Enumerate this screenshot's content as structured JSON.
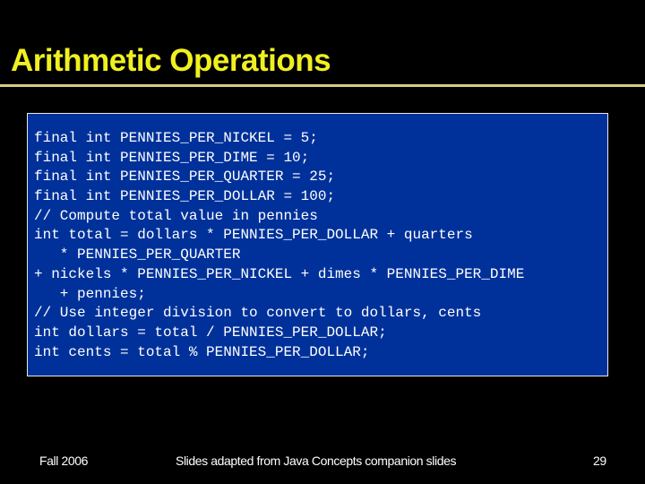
{
  "slide": {
    "title": "Arithmetic Operations",
    "code_lines": [
      "final int PENNIES_PER_NICKEL = 5;",
      "final int PENNIES_PER_DIME = 10;",
      "final int PENNIES_PER_QUARTER = 25;",
      "final int PENNIES_PER_DOLLAR = 100;",
      "// Compute total value in pennies",
      "int total = dollars * PENNIES_PER_DOLLAR + quarters",
      "   * PENNIES_PER_QUARTER",
      "+ nickels * PENNIES_PER_NICKEL + dimes * PENNIES_PER_DIME",
      "   + pennies;",
      "// Use integer division to convert to dollars, cents",
      "int dollars = total / PENNIES_PER_DOLLAR;",
      "int cents = total % PENNIES_PER_DOLLAR;"
    ],
    "colors": {
      "background": "#000000",
      "title": "#F0F020",
      "rule": "#D8CC80",
      "code_box": "#00319A",
      "code_text": "#FFFFFF"
    }
  },
  "footer": {
    "date": "Fall 2006",
    "center": "Slides adapted from Java Concepts companion slides",
    "page_number": "29"
  }
}
